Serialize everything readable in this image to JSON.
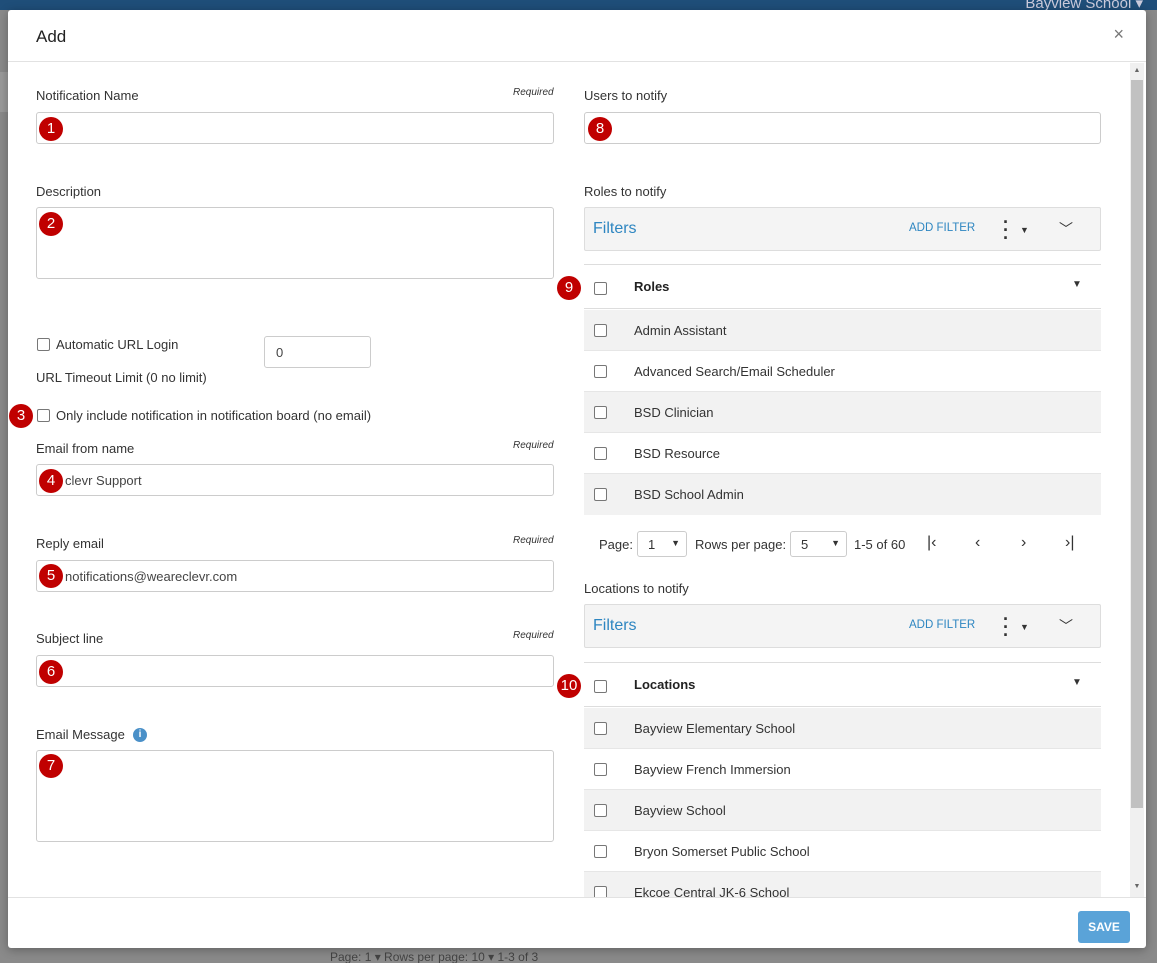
{
  "background": {
    "school": "Bayview School ▾",
    "pager": "Page: 1 ▾ Rows per page: 10 ▾ 1-3 of 3"
  },
  "modal": {
    "title": "Add",
    "close": "×",
    "save_label": "SAVE"
  },
  "required_text": "Required",
  "badges": [
    "1",
    "2",
    "3",
    "4",
    "5",
    "6",
    "7",
    "8",
    "9",
    "10"
  ],
  "left": {
    "notification_name": {
      "label": "Notification Name",
      "value": ""
    },
    "description": {
      "label": "Description",
      "value": ""
    },
    "auto_url_login": {
      "label": "Automatic URL Login",
      "checked": false
    },
    "url_timeout": {
      "label": "URL Timeout Limit (0 no limit)",
      "value": "0"
    },
    "only_board": {
      "label": "Only include notification in notification board (no email)",
      "checked": false
    },
    "email_from": {
      "label": "Email from name",
      "value": "clevr Support"
    },
    "reply_email": {
      "label": "Reply email",
      "value": "notifications@weareclevr.com"
    },
    "subject": {
      "label": "Subject line",
      "value": ""
    },
    "email_message": {
      "label": "Email Message",
      "info_glyph": "i",
      "value": ""
    }
  },
  "right": {
    "users": {
      "label": "Users to notify",
      "value": ""
    },
    "roles": {
      "label": "Roles to notify",
      "filters_title": "Filters",
      "add_filter": "ADD FILTER",
      "column": "Roles",
      "rows": [
        "Admin Assistant",
        "Advanced Search/Email Scheduler",
        "BSD Clinician",
        "BSD Resource",
        "BSD School Admin"
      ]
    },
    "pager": {
      "page_label": "Page:",
      "page_value": "1",
      "rows_label": "Rows per page:",
      "rows_value": "5",
      "range": "1-5 of 60"
    },
    "locations": {
      "label": "Locations to notify",
      "filters_title": "Filters",
      "add_filter": "ADD FILTER",
      "column": "Locations",
      "rows": [
        "Bayview Elementary School",
        "Bayview French Immersion",
        "Bayview School",
        "Bryon Somerset Public School",
        "Ekcoe Central JK-6 School"
      ]
    }
  },
  "colors": {
    "accent": "#2e86c1",
    "badge": "#c00000",
    "save": "#5aa3d8"
  }
}
